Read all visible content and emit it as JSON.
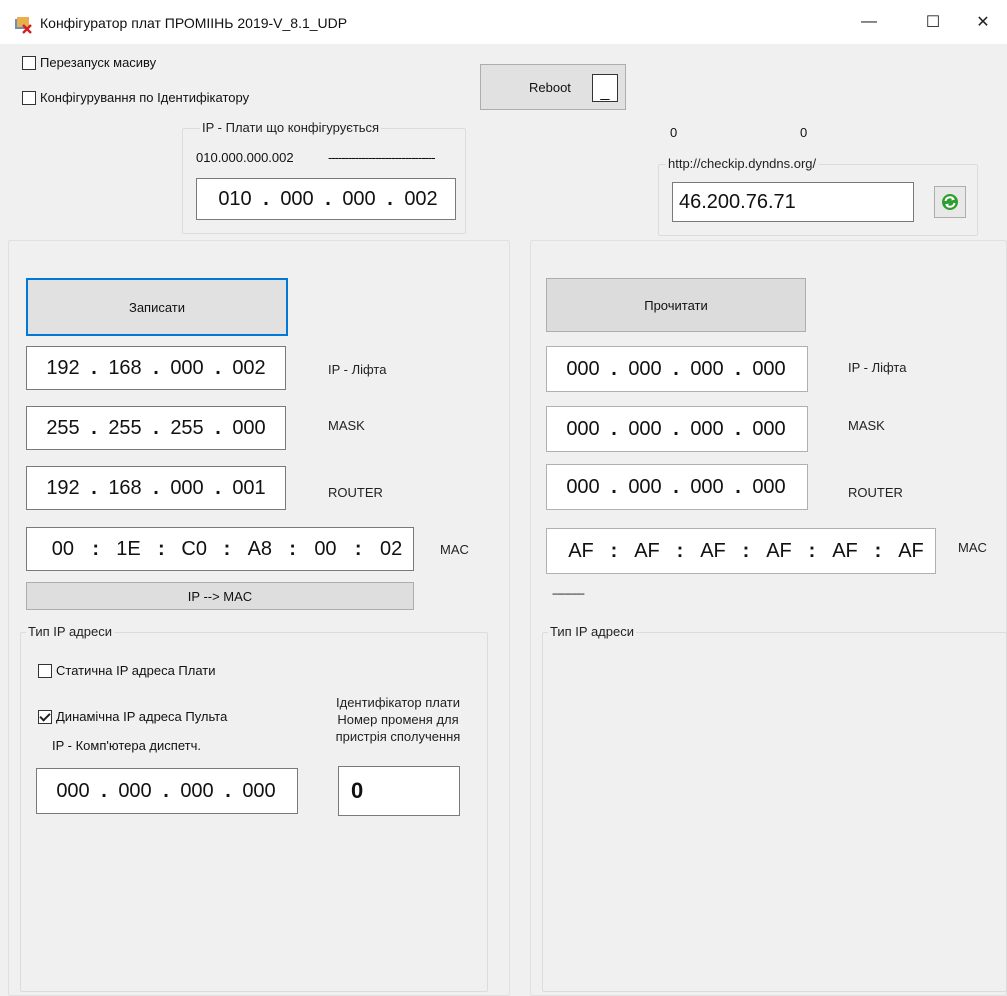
{
  "window": {
    "title": "Конфігуратор плат ПРОМІІНЬ 2019-V_8.1_UDP",
    "minimize": "—",
    "maximize": "☐",
    "close": "✕"
  },
  "top": {
    "restart_array": "Перезапуск масиву",
    "config_by_id": "Конфігурування по Ідентифікатору",
    "reboot_label": "Reboot",
    "reboot_box": "_",
    "board_group_legend": "IP - Плати що конфігурується",
    "board_ip_text": "010.000.000.002",
    "board_ip_dashes": "--------------------------------",
    "board_ip": [
      "010",
      "000",
      "000",
      "002"
    ],
    "counter_a": "0",
    "counter_b": "0",
    "checkip_legend": "http://checkip.dyndns.org/",
    "external_ip": "46.200.76.71"
  },
  "left": {
    "write_button": "Записати",
    "ip_lift": [
      "192",
      "168",
      "000",
      "002"
    ],
    "ip_lift_label": "IP - Ліфта",
    "mask": [
      "255",
      "255",
      "255",
      "000"
    ],
    "mask_label": "MASK",
    "router": [
      "192",
      "168",
      "000",
      "001"
    ],
    "router_label": "ROUTER",
    "mac": [
      "00",
      "1E",
      "C0",
      "A8",
      "00",
      "02"
    ],
    "mac_label": "MAC",
    "ip_to_mac_button": "IP --> MAC",
    "ip_type_legend": "Тип IP адреси",
    "static_ip": "Статична IP адреса Плати",
    "dynamic_ip": "Динамічна IP адреса Пульта",
    "dispatcher_ip_label": "IP - Комп'ютера диспетч.",
    "dispatcher_ip": [
      "000",
      "000",
      "000",
      "000"
    ],
    "board_id_line1": "Ідентифікатор плати",
    "board_id_line2": "Номер променя для",
    "board_id_line3": "пристрія сполучення",
    "board_id_value": "0"
  },
  "right": {
    "read_button": "Прочитати",
    "ip_lift": [
      "000",
      "000",
      "000",
      "000"
    ],
    "ip_lift_label": "IP - Ліфта",
    "mask": [
      "000",
      "000",
      "000",
      "000"
    ],
    "mask_label": "MASK",
    "router": [
      "000",
      "000",
      "000",
      "000"
    ],
    "router_label": "ROUTER",
    "mac": [
      "AF",
      "AF",
      "AF",
      "AF",
      "AF",
      "AF"
    ],
    "mac_label": "MAC",
    "dashes": "------------",
    "ip_type_legend": "Тип IP адреси"
  },
  "colors": {
    "window_bg": "#f0f0f0",
    "focus_border": "#0078d7",
    "refresh_green": "#2e9e2e"
  },
  "icons": {
    "app": "app-icon",
    "refresh": "refresh-icon"
  }
}
